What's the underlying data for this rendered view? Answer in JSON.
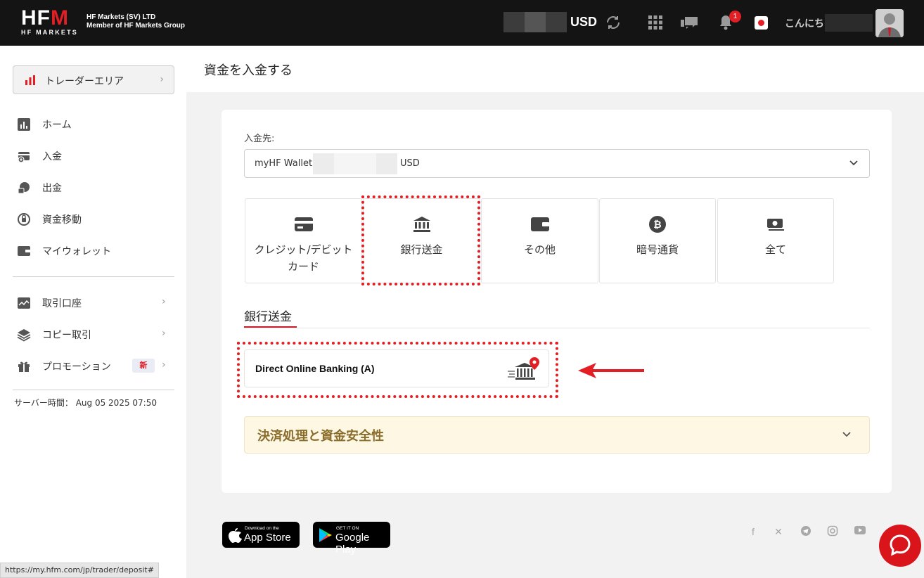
{
  "header": {
    "logo_text": "HFM",
    "logo_sub": "HF MARKETS",
    "company_line1": "HF Markets (SV) LTD",
    "company_line2": "Member of HF Markets Group",
    "currency": "USD",
    "notification_count": "1",
    "greeting": "こんにちは",
    "icons": [
      "refresh-icon",
      "apps-grid-icon",
      "chat-icon",
      "bell-icon",
      "japan-flag-icon",
      "avatar"
    ]
  },
  "sidebar": {
    "trader_area": "トレーダーエリア",
    "items": [
      {
        "label": "ホーム",
        "icon": "chart-icon"
      },
      {
        "label": "入金",
        "icon": "deposit-icon"
      },
      {
        "label": "出金",
        "icon": "withdraw-icon"
      },
      {
        "label": "資金移動",
        "icon": "transfer-icon"
      },
      {
        "label": "マイウォレット",
        "icon": "wallet-icon"
      }
    ],
    "items2": [
      {
        "label": "取引口座",
        "icon": "trading-accounts-icon"
      },
      {
        "label": "コピー取引",
        "icon": "layers-icon"
      },
      {
        "label": "プロモーション",
        "icon": "gift-icon",
        "badge": "新"
      }
    ],
    "server_time_label": "サーバー時間：",
    "server_time": "Aug 05 2025 07:50"
  },
  "status_url": "https://my.hfm.com/jp/trader/deposit#",
  "main": {
    "title": "資金を入金する",
    "deposit_to_label": "入金先:",
    "wallet_label": "myHF Wallet:",
    "wallet_currency": "USD",
    "tabs": [
      {
        "label": "クレジット/デビットカード",
        "icon": "credit-card-icon"
      },
      {
        "label": "銀行送金",
        "icon": "bank-icon"
      },
      {
        "label": "その他",
        "icon": "wallet-icon"
      },
      {
        "label": "暗号通貨",
        "icon": "bitcoin-icon"
      },
      {
        "label": "全て",
        "icon": "cash-icon"
      }
    ],
    "section_title": "銀行送金",
    "method_name": "Direct Online Banking (A)",
    "accordion_title": "決済処理と資金安全性"
  },
  "footer": {
    "appstore_small": "Download on the",
    "appstore_big": "App Store",
    "googleplay_small": "GET IT ON",
    "googleplay_big": "Google Play",
    "social": [
      "facebook-icon",
      "x-icon",
      "telegram-icon",
      "instagram-icon",
      "youtube-icon"
    ]
  },
  "colors": {
    "brand_red": "#e31e24",
    "topbar": "#141414",
    "accordion_bg": "#fdf7e3"
  }
}
